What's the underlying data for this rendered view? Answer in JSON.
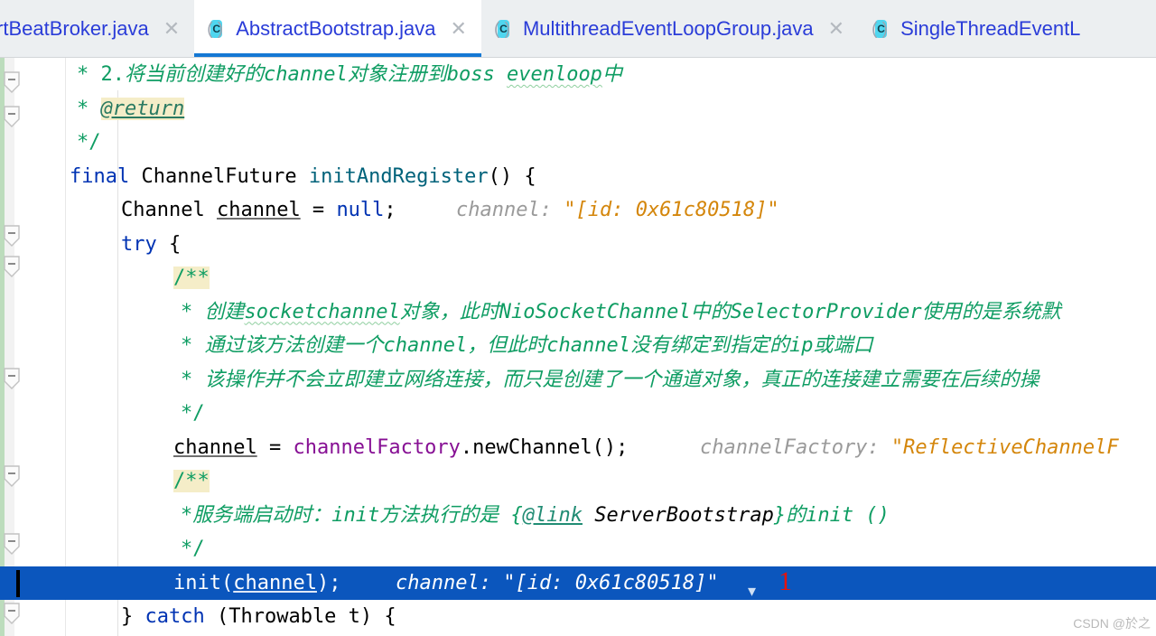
{
  "window": {
    "app": "IntelliJ IDEA Editor",
    "watermark": "CSDN @於之"
  },
  "tabs": [
    {
      "label": "rtBeatBroker.java",
      "icon": "java-class-icon",
      "close_icon": "close-icon",
      "active": false,
      "truncated_left": true
    },
    {
      "label": "AbstractBootstrap.java",
      "icon": "java-class-icon",
      "close_icon": "close-icon",
      "active": true,
      "truncated_left": false
    },
    {
      "label": "MultithreadEventLoopGroup.java",
      "icon": "java-class-icon",
      "close_icon": "close-icon",
      "active": false,
      "truncated_left": false
    },
    {
      "label": "SingleThreadEventL",
      "icon": "java-class-icon",
      "close_icon": "close-icon",
      "active": false,
      "truncated_left": false
    }
  ],
  "editor": {
    "file": "AbstractBootstrap.java",
    "selected_line_index": 14,
    "caret_visible": true,
    "annotation": {
      "red_number": "1",
      "chevron": "chevron-down-icon"
    },
    "colors": {
      "keyword": "#0033b3",
      "comment": "#13a46a",
      "string": "#e08b1a",
      "method": "#00627a",
      "field": "#871094",
      "inlay_hint": "#9a9a9a",
      "selection_bg": "#0b56bd",
      "doc_highlight_bg": "#f5edc8",
      "change_stripe": "#bcdcbc",
      "tab_text": "#2a3cd8",
      "active_tab_underline": "#1478d4",
      "annotation_red": "#e81309"
    },
    "lines": [
      {
        "id": "l1",
        "indent": 5,
        "text": "* 2.将当前创建好的channel对象注册到boss evenloop中"
      },
      {
        "id": "l2",
        "indent": 5,
        "text": "* @return"
      },
      {
        "id": "l3",
        "indent": 5,
        "text": "*/"
      },
      {
        "id": "l4",
        "indent": 4,
        "text": "final ChannelFuture initAndRegister() {"
      },
      {
        "id": "l5",
        "indent": 8,
        "text": "Channel channel = null;",
        "hint": "channel: \"[id: 0x61c80518]\""
      },
      {
        "id": "l6",
        "indent": 8,
        "text": "try {"
      },
      {
        "id": "l7",
        "indent": 11,
        "text": "/**"
      },
      {
        "id": "l8",
        "indent": 12,
        "text": "* 创建socketchannel对象，此时NioSocketChannel中的SelectorProvider使用的是系统默"
      },
      {
        "id": "l9",
        "indent": 12,
        "text": "* 通过该方法创建一个channel，但此时channel没有绑定到指定的ip或端口"
      },
      {
        "id": "l10",
        "indent": 12,
        "text": "* 该操作并不会立即建立网络连接，而只是创建了一个通道对象，真正的连接建立需要在后续的操"
      },
      {
        "id": "l11",
        "indent": 12,
        "text": "*/"
      },
      {
        "id": "l12",
        "indent": 11,
        "text": "channel = channelFactory.newChannel();",
        "hint": "channelFactory: \"ReflectiveChannelF"
      },
      {
        "id": "l13",
        "indent": 11,
        "text": "/**"
      },
      {
        "id": "l14",
        "indent": 12,
        "text": "*服务端启动时：init方法执行的是 {@link ServerBootstrap}的init ()"
      },
      {
        "id": "l15",
        "indent": 12,
        "text": "*/"
      },
      {
        "id": "l16",
        "indent": 11,
        "text": "init(channel);",
        "hint": "channel: \"[id: 0x61c80518]\"",
        "selected": true
      },
      {
        "id": "l17",
        "indent": 8,
        "text": "} catch (Throwable t) {"
      }
    ],
    "gutter": {
      "fold_markers": [
        "collapse-icon",
        "collapse-icon",
        "collapse-icon",
        "collapse-icon",
        "collapse-icon",
        "collapse-icon",
        "collapse-icon",
        "collapse-icon"
      ]
    }
  }
}
